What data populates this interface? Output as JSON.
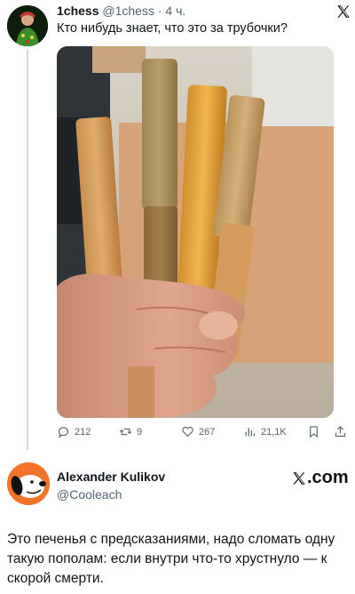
{
  "tweet": {
    "name": "1chess",
    "handle": "@1chess",
    "separator": "·",
    "time": "4 ч.",
    "text": "Кто нибудь знает, что это за трубочки?",
    "actions": {
      "replies": "212",
      "retweets": "9",
      "likes": "267",
      "views": "21,1K"
    }
  },
  "quote_card": {
    "name": "Alexander Kulikov",
    "handle": "@Cooleach",
    "brand": ".com",
    "text": "Это печенья с предсказаниями, надо сломать одну такую пополам: если внутри что-то хрустнуло — к скорой смерти."
  },
  "colors": {
    "text_primary": "#0f1419",
    "text_secondary": "#536471",
    "divider": "#cfd9de",
    "avatar2_bg": "#f4732a"
  }
}
